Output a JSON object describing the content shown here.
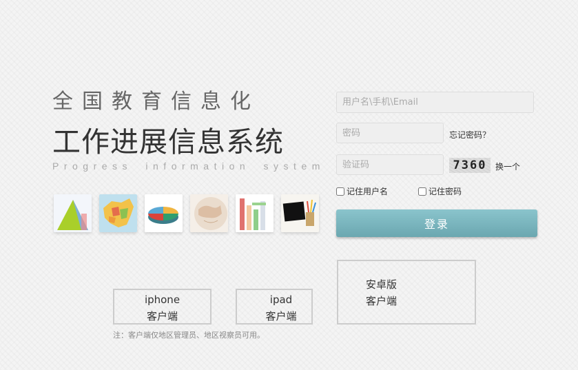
{
  "brand": {
    "title_line1": "全国教育信息化",
    "title_line2": "工作进展信息系统",
    "subtitle_en": "Progress information system"
  },
  "thumbnails": [
    {
      "icon": "triangle-chart-icon"
    },
    {
      "icon": "china-map-icon"
    },
    {
      "icon": "pie-chart-icon"
    },
    {
      "icon": "globe-icon"
    },
    {
      "icon": "bar-chart-icon"
    },
    {
      "icon": "tablet-pencils-icon"
    }
  ],
  "login": {
    "username_placeholder": "用户名\\手机\\Email",
    "password_placeholder": "密码",
    "forgot_password": "忘记密码？",
    "captcha_placeholder": "验证码",
    "captcha_code": "7360",
    "refresh_captcha": "换一个",
    "remember_username": "记住用户名",
    "remember_password": "记住密码",
    "submit_label": "登录"
  },
  "clients": {
    "iphone_line1": "iphone",
    "iphone_line2": "客户端",
    "ipad_line1": "ipad",
    "ipad_line2": "客户端",
    "android_line1": "安卓版",
    "android_line2": "客户端",
    "note": "注：客户端仅地区管理员、地区视察员可用。"
  },
  "colors": {
    "login_button": "#7bb6be",
    "background": "#f4f4f4"
  }
}
